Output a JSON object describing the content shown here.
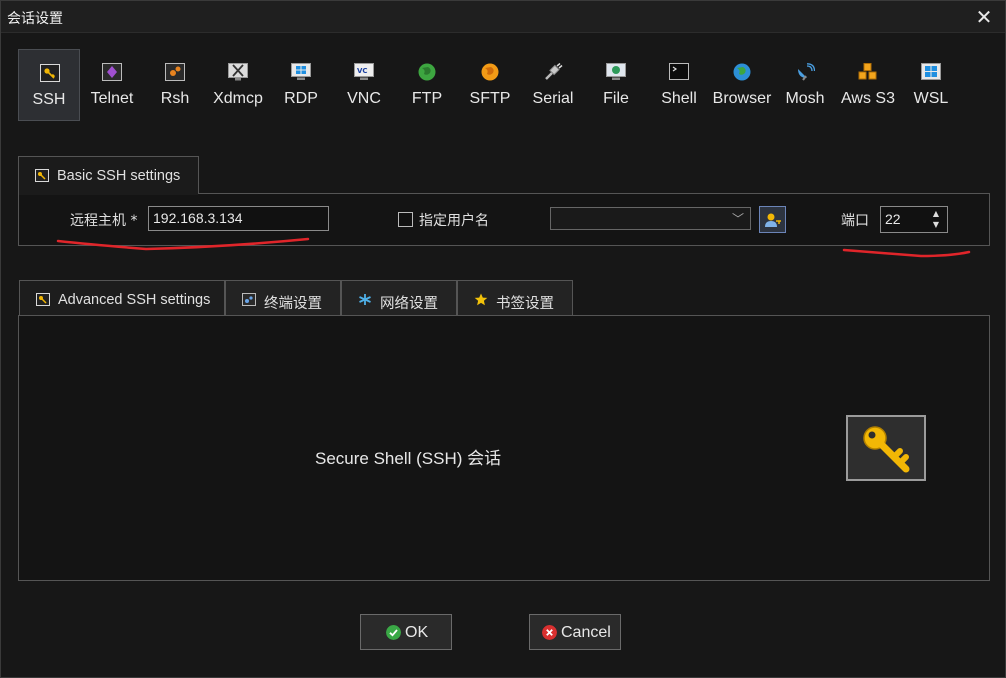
{
  "window": {
    "title": "会话设置",
    "close_glyph": "✕"
  },
  "protocols": [
    {
      "label": "SSH",
      "icon": "key-icon",
      "selected": true
    },
    {
      "label": "Telnet",
      "icon": "telnet-icon"
    },
    {
      "label": "Rsh",
      "icon": "rsh-icon"
    },
    {
      "label": "Xdmcp",
      "icon": "x-display-icon"
    },
    {
      "label": "RDP",
      "icon": "windows-remote-icon"
    },
    {
      "label": "VNC",
      "icon": "vnc-icon"
    },
    {
      "label": "FTP",
      "icon": "globe-green-icon"
    },
    {
      "label": "SFTP",
      "icon": "globe-orange-icon"
    },
    {
      "label": "Serial",
      "icon": "serial-plug-icon"
    },
    {
      "label": "File",
      "icon": "monitor-globe-icon"
    },
    {
      "label": "Shell",
      "icon": "terminal-icon"
    },
    {
      "label": "Browser",
      "icon": "globe-blue-icon"
    },
    {
      "label": "Mosh",
      "icon": "satellite-dish-icon"
    },
    {
      "label": "Aws S3",
      "icon": "aws-cubes-icon"
    },
    {
      "label": "WSL",
      "icon": "windows-logo-icon"
    }
  ],
  "basic": {
    "tab_label": "Basic SSH settings",
    "remote_host_label": "远程主机 *",
    "remote_host_value": "192.168.3.134",
    "specify_user_label": "指定用户名",
    "specify_user_checked": false,
    "username_value": "",
    "port_label": "端口",
    "port_value": "22"
  },
  "tabs": [
    {
      "label": "Advanced SSH settings",
      "icon": "key-icon"
    },
    {
      "label": "终端设置",
      "icon": "terminal-settings-icon"
    },
    {
      "label": "网络设置",
      "icon": "network-icon"
    },
    {
      "label": "书签设置",
      "icon": "star-icon"
    }
  ],
  "main": {
    "description": "Secure Shell (SSH) 会话"
  },
  "buttons": {
    "ok": "OK",
    "cancel": "Cancel"
  },
  "colors": {
    "annotation_red": "#e0252a",
    "ok_green": "#3aa846",
    "cancel_red": "#d93030",
    "key_gold": "#f2b705"
  }
}
